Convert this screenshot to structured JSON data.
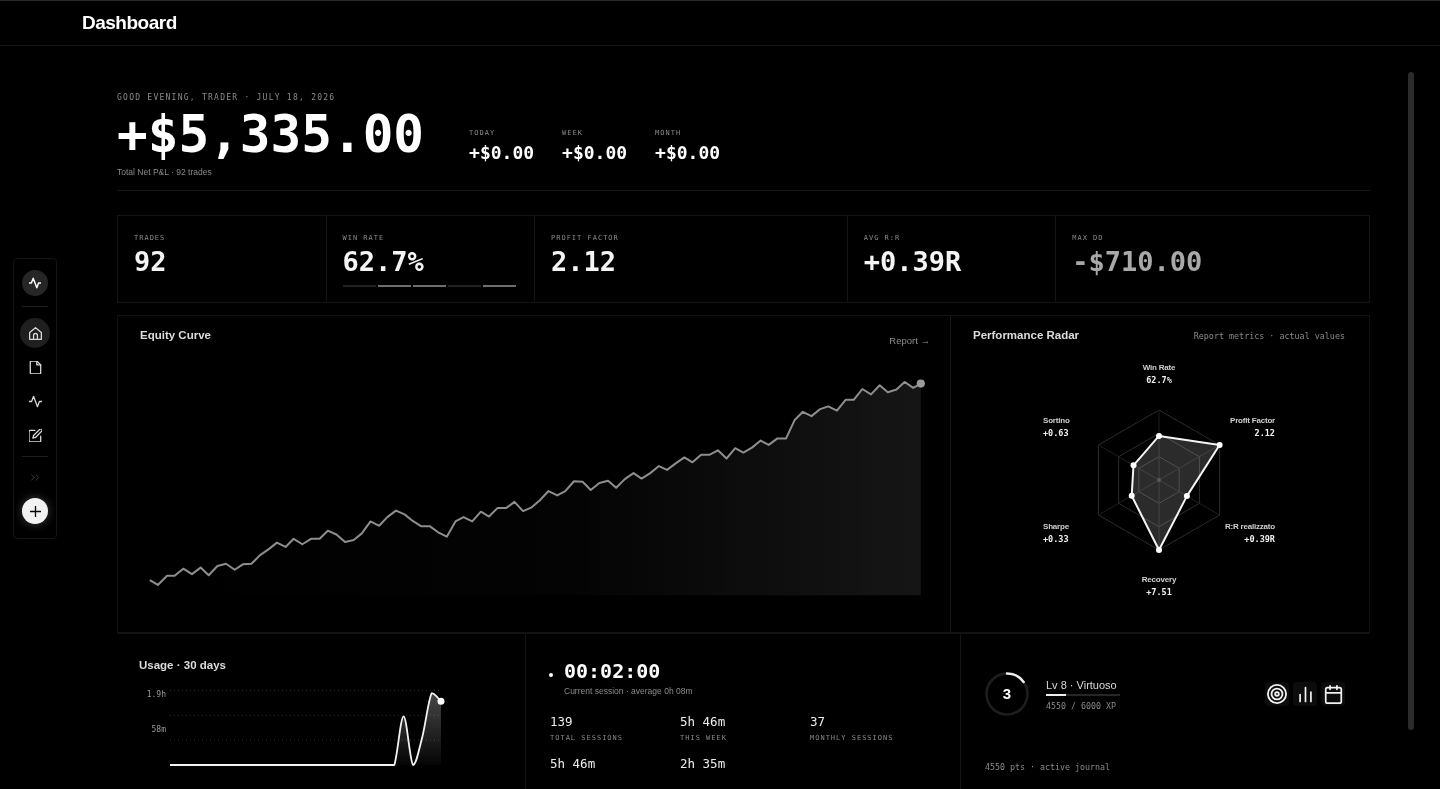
{
  "header": {
    "title": "Dashboard"
  },
  "sidebar": {
    "items": [
      {
        "selected": true
      },
      {
        "selected": false
      },
      {
        "selected": false
      },
      {
        "selected": false
      }
    ]
  },
  "hero": {
    "greeting": "GOOD EVENING, TRADER · JULY 18, 2026",
    "total": "+$5,335.00",
    "caption": "Total Net P&L · 92 trades",
    "periods": [
      {
        "label": "TODAY",
        "value": "+$0.00"
      },
      {
        "label": "WEEK",
        "value": "+$0.00"
      },
      {
        "label": "MONTH",
        "value": "+$0.00"
      }
    ]
  },
  "metrics": [
    {
      "label": "TRADES",
      "value": "92",
      "negative": false
    },
    {
      "label": "WIN RATE",
      "value": "62.7%",
      "negative": false,
      "segments": [
        {
          "on": false
        },
        {
          "on": true
        },
        {
          "on": true
        },
        {
          "on": false
        },
        {
          "on": true
        }
      ]
    },
    {
      "label": "PROFIT FACTOR",
      "value": "2.12",
      "negative": false
    },
    {
      "label": "AVG R:R",
      "value": "+0.39R",
      "negative": false
    },
    {
      "label": "MAX DD",
      "value": "-$710.00",
      "negative": true
    }
  ],
  "equity_curve": {
    "title": "Equity Curve",
    "link": "Report →"
  },
  "radar": {
    "title": "Performance Radar",
    "note": "Report metrics · actual values",
    "axes": [
      {
        "name": "Win Rate",
        "reading": "62.7%"
      },
      {
        "name": "Sortino",
        "reading": "+0.63"
      },
      {
        "name": "Profit Factor",
        "reading": "2.12"
      },
      {
        "name": "Sharpe",
        "reading": "+0.33"
      },
      {
        "name": "R:R realizzato",
        "reading": "+0.39R"
      },
      {
        "name": "Recovery",
        "reading": "+7.51"
      }
    ]
  },
  "usage": {
    "title": "Usage · 30 days",
    "axis_labels": [
      "1.9h",
      "58m"
    ]
  },
  "session": {
    "timer": "00:02:00",
    "caption": "Current session · average 0h 08m",
    "stats": [
      {
        "value": "139",
        "label": "TOTAL SESSIONS"
      },
      {
        "value": "5h 46m",
        "label": "THIS WEEK"
      },
      {
        "value": "37",
        "label": "MONTHLY SESSIONS"
      },
      {
        "value": "5h 46m"
      },
      {
        "value": "2h 35m"
      }
    ]
  },
  "progress": {
    "ring": {
      "value": "3",
      "level": 0.15
    },
    "rank": "Lv 8 · Virtuoso",
    "xp_bar": {
      "level": 0.27
    },
    "xp": "4550 / 6000 XP",
    "footer": "4550 pts · active journal"
  }
}
